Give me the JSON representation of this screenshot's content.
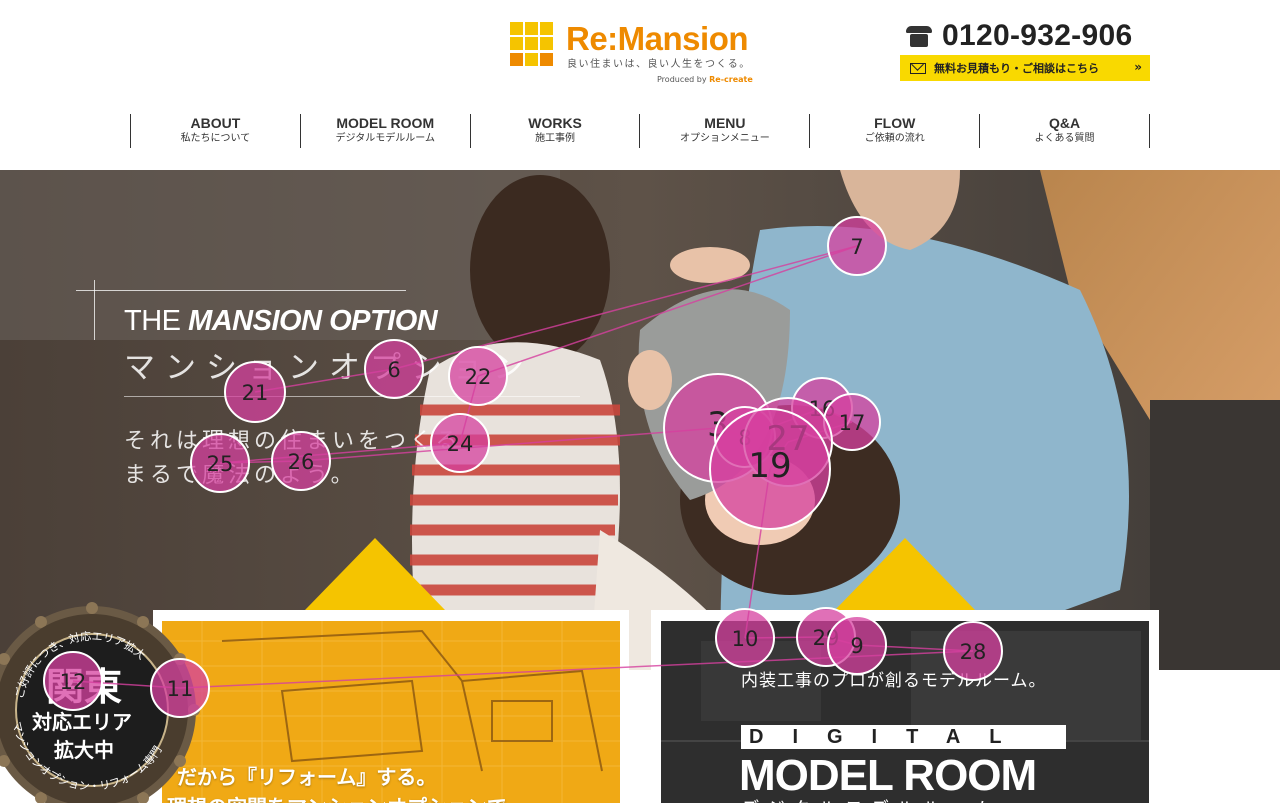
{
  "header": {
    "logo_name": "Re:Mansion",
    "logo_tagline": "良い住まいは、良い人生をつくる。",
    "logo_produced_by": "Produced by",
    "logo_producer": "Re-create",
    "phone_number": "0120-932-906",
    "quote_button_label": "無料お見積もり・ご相談はこちら",
    "quote_button_chevron": "»"
  },
  "nav": [
    {
      "en": "ABOUT",
      "jp": "私たちについて"
    },
    {
      "en": "MODEL ROOM",
      "jp": "デジタルモデルルーム"
    },
    {
      "en": "WORKS",
      "jp": "施工事例"
    },
    {
      "en": "MENU",
      "jp": "オプションメニュー"
    },
    {
      "en": "FLOW",
      "jp": "ご依頼の流れ"
    },
    {
      "en": "Q&A",
      "jp": "よくある質問"
    }
  ],
  "hero": {
    "title_prefix": "THE ",
    "title_bold": "MANSION OPTION",
    "subtitle": "マンションオプション",
    "catch_line1": "それは理想の住まいをつくる",
    "catch_line2": "まるで魔法のよう。"
  },
  "cards": {
    "left_line1": "だから『リフォーム』する。",
    "left_line2": "理想の空間をマンションオプションで",
    "right_subtitle": "内装工事のプロが創るモデルルーム。",
    "right_digital": "DIGITAL",
    "right_title": "MODEL ROOM",
    "right_kana": "デジタルモデルルーム"
  },
  "badge": {
    "region": "関東",
    "line1": "対応エリア",
    "line2": "拡大中",
    "ring_top": "ご好評につき、対応エリア拡大",
    "ring_bottom": "マンションオプション・リフォーム専門"
  },
  "overlay_markers": [
    {
      "n": "7"
    },
    {
      "n": "6"
    },
    {
      "n": "21"
    },
    {
      "n": "22"
    },
    {
      "n": "24"
    },
    {
      "n": "25"
    },
    {
      "n": "26"
    },
    {
      "n": "3"
    },
    {
      "n": "8"
    },
    {
      "n": "16"
    },
    {
      "n": "17"
    },
    {
      "n": "27"
    },
    {
      "n": "19"
    },
    {
      "n": "10"
    },
    {
      "n": "29"
    },
    {
      "n": "9"
    },
    {
      "n": "28"
    },
    {
      "n": "11"
    },
    {
      "n": "12"
    }
  ],
  "colors": {
    "brand_orange": "#ee8a00",
    "brand_yellow": "#f5c400",
    "cta_yellow": "#f9d900",
    "marker_pink": "#d6409f"
  }
}
